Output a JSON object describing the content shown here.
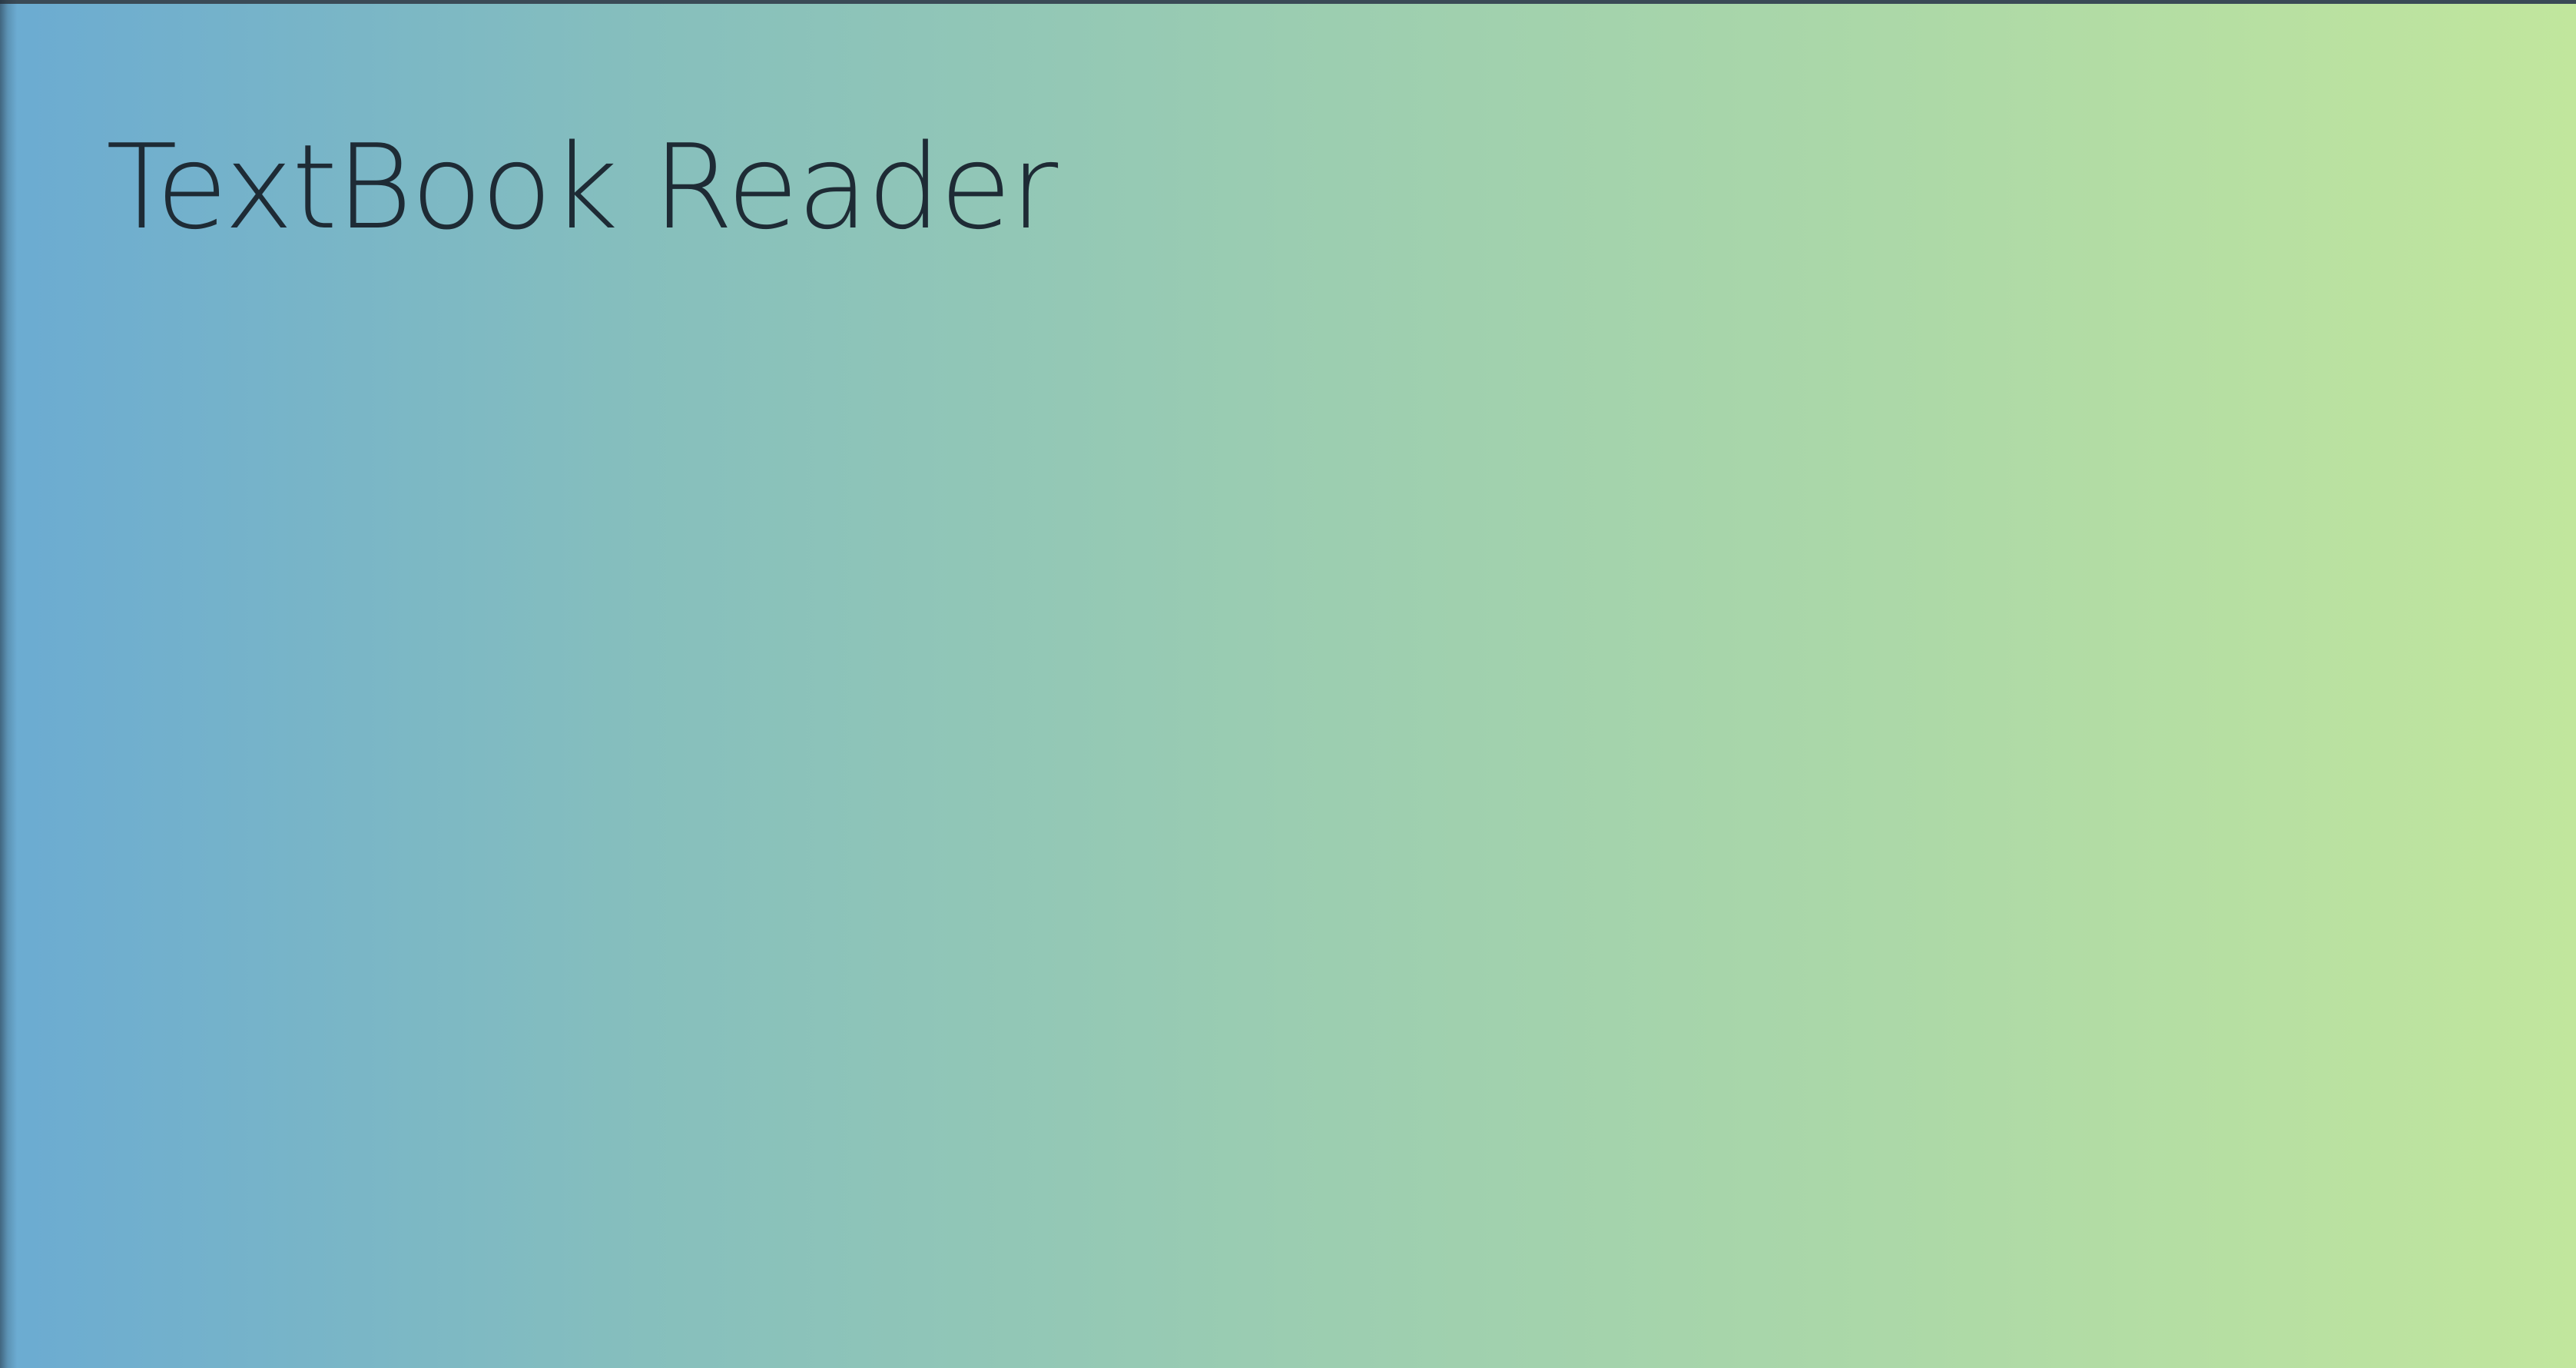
{
  "app": {
    "title": "TextBook Reader"
  },
  "colors": {
    "gradient_start": "#6babd2",
    "gradient_mid": "#9bcdb1",
    "gradient_end": "#c1e69d",
    "title_text": "#1e2b35"
  }
}
